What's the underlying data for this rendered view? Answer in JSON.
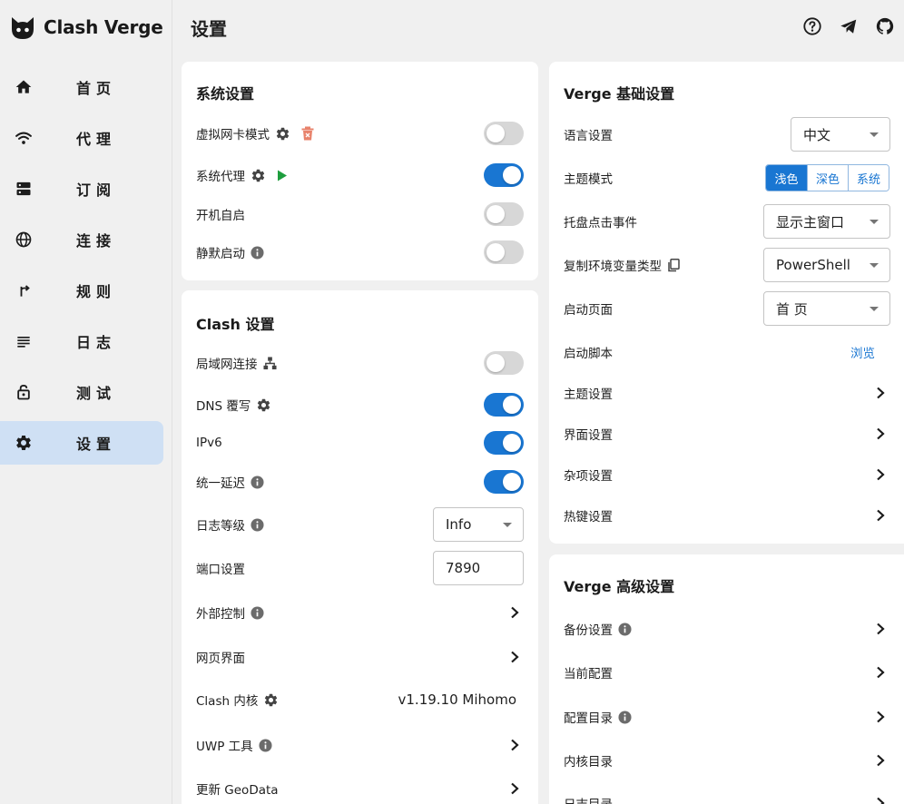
{
  "app": {
    "name": "Clash Verge"
  },
  "sidebar": {
    "items": [
      {
        "label": "首页",
        "icon": "home-icon"
      },
      {
        "label": "代理",
        "icon": "wifi-icon"
      },
      {
        "label": "订阅",
        "icon": "dns-icon"
      },
      {
        "label": "连接",
        "icon": "globe-icon"
      },
      {
        "label": "规则",
        "icon": "fork-arrow-icon"
      },
      {
        "label": "日志",
        "icon": "list-icon"
      },
      {
        "label": "测试",
        "icon": "lock-icon"
      },
      {
        "label": "设置",
        "icon": "gear-icon",
        "active": true
      }
    ]
  },
  "header": {
    "title": "设置",
    "icons": [
      "help-icon",
      "telegram-icon",
      "github-icon"
    ]
  },
  "system_settings": {
    "title": "系统设置",
    "rows": [
      {
        "label": "虚拟网卡模式",
        "toggle": false
      },
      {
        "label": "系统代理",
        "toggle": true
      },
      {
        "label": "开机自启",
        "toggle": false
      },
      {
        "label": "静默启动",
        "toggle": false
      }
    ]
  },
  "clash_settings": {
    "title": "Clash 设置",
    "lan_label": "局域网连接",
    "lan_toggle": false,
    "dns_label": "DNS 覆写",
    "dns_toggle": true,
    "ipv6_label": "IPv6",
    "ipv6_toggle": true,
    "delay_label": "统一延迟",
    "delay_toggle": true,
    "log_level_label": "日志等级",
    "log_level_value": "Info",
    "port_label": "端口设置",
    "port_value": "7890",
    "external_label": "外部控制",
    "web_ui_label": "网页界面",
    "core_label": "Clash 内核",
    "core_version": "v1.19.10 Mihomo",
    "uwp_label": "UWP 工具",
    "geodata_label": "更新 GeoData"
  },
  "verge_basic": {
    "title": "Verge 基础设置",
    "language_label": "语言设置",
    "language_value": "中文",
    "theme_mode_label": "主题模式",
    "theme_options": [
      "浅色",
      "深色",
      "系统"
    ],
    "theme_active": "浅色",
    "tray_label": "托盘点击事件",
    "tray_value": "显示主窗口",
    "env_label": "复制环境变量类型",
    "env_value": "PowerShell",
    "start_page_label": "启动页面",
    "start_page_value": "首 页",
    "start_script_label": "启动脚本",
    "start_script_action": "浏览",
    "theme_settings_label": "主题设置",
    "ui_settings_label": "界面设置",
    "misc_settings_label": "杂项设置",
    "hotkey_settings_label": "热键设置"
  },
  "verge_advanced": {
    "title": "Verge 高级设置",
    "backup_label": "备份设置",
    "current_config_label": "当前配置",
    "config_dir_label": "配置目录",
    "core_dir_label": "内核目录",
    "log_dir_label": "日志目录"
  },
  "colors": {
    "accent": "#1976d2",
    "active_nav": "#cfe0f4",
    "play": "#1e9e3e",
    "trash": "#e8826b"
  }
}
